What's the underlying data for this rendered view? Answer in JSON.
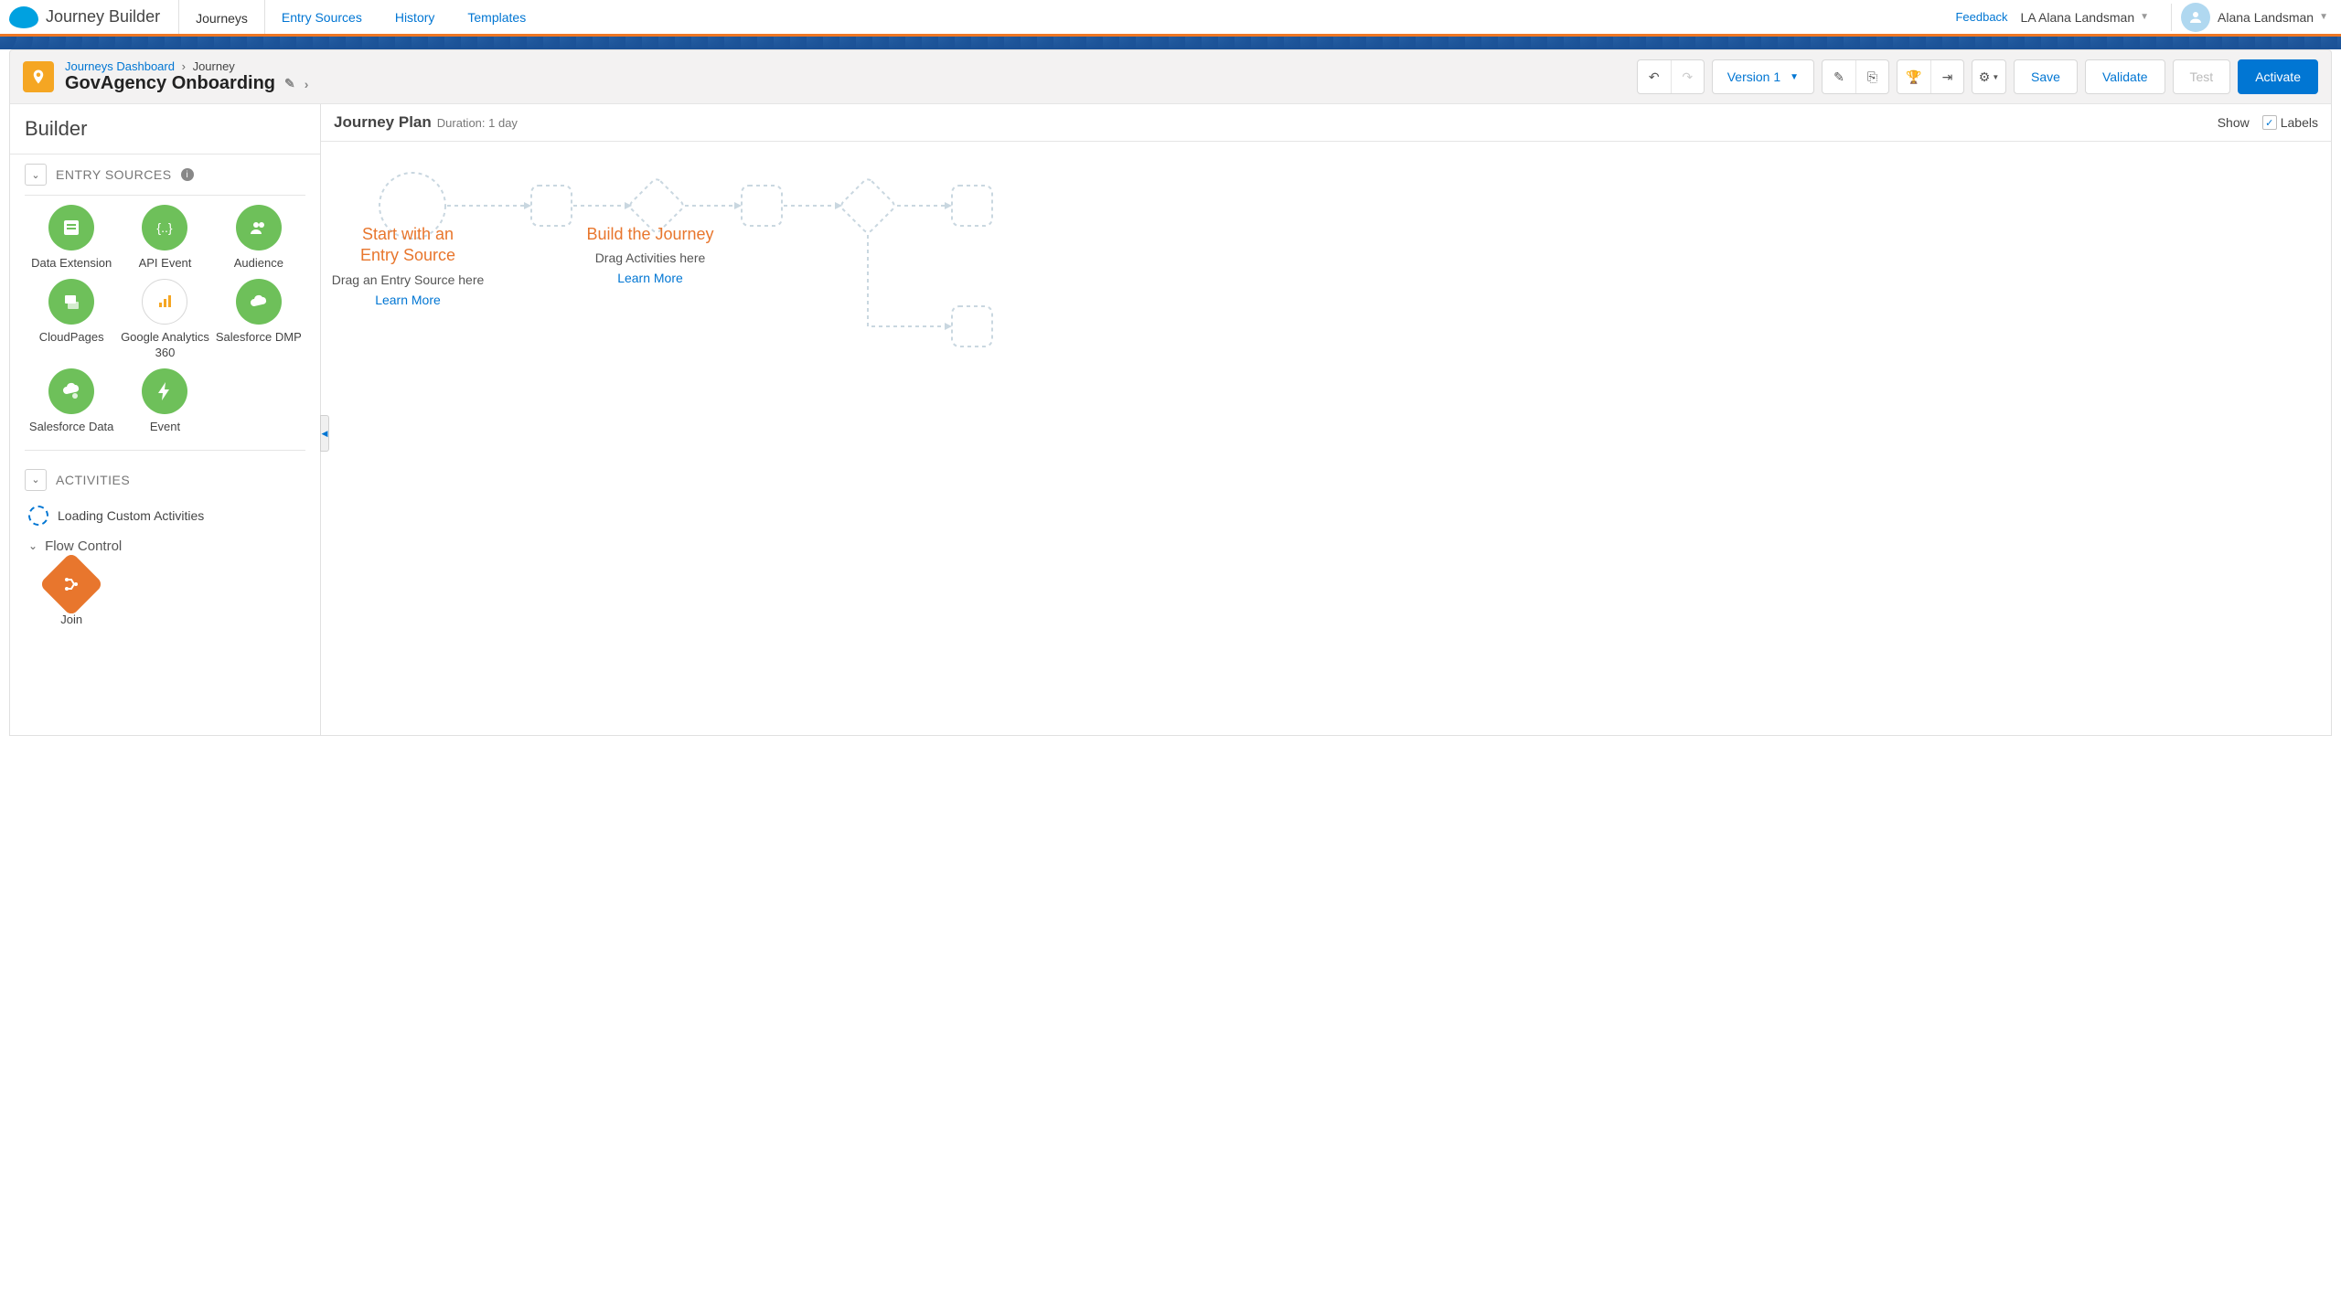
{
  "brand": "Journey Builder",
  "nav": {
    "tabs": [
      "Journeys",
      "Entry Sources",
      "History",
      "Templates"
    ],
    "active_index": 0,
    "feedback": "Feedback",
    "org_prefix": "LA",
    "org": "Alana Landsman",
    "user": "Alana Landsman"
  },
  "breadcrumb": {
    "root": "Journeys Dashboard",
    "current": "Journey"
  },
  "journey_title": "GovAgency Onboarding",
  "version_label": "Version 1",
  "buttons": {
    "save": "Save",
    "validate": "Validate",
    "test": "Test",
    "activate": "Activate"
  },
  "sidebar": {
    "title": "Builder",
    "sections": {
      "entry_sources": {
        "label": "ENTRY SOURCES",
        "items": [
          {
            "label": "Data Extension",
            "icon": "list"
          },
          {
            "label": "API Event",
            "icon": "braces"
          },
          {
            "label": "Audience",
            "icon": "people"
          },
          {
            "label": "CloudPages",
            "icon": "pages"
          },
          {
            "label": "Google Analytics 360",
            "icon": "ga"
          },
          {
            "label": "Salesforce DMP",
            "icon": "cloud"
          },
          {
            "label": "Salesforce Data",
            "icon": "cloudpin"
          },
          {
            "label": "Event",
            "icon": "bolt"
          }
        ]
      },
      "activities": {
        "label": "ACTIVITIES",
        "loading": "Loading Custom Activities"
      },
      "flow_control": {
        "label": "Flow Control",
        "items": [
          {
            "label": "Join",
            "icon": "join"
          }
        ]
      }
    }
  },
  "canvas": {
    "title": "Journey Plan",
    "duration": "Duration: 1 day",
    "show_label": "Show",
    "labels_checkbox": "Labels",
    "hints": {
      "entry": {
        "title1": "Start with an",
        "title2": "Entry Source",
        "sub": "Drag an Entry Source here",
        "link": "Learn More"
      },
      "build": {
        "title": "Build the Journey",
        "sub": "Drag Activities here",
        "link": "Learn More"
      }
    }
  }
}
